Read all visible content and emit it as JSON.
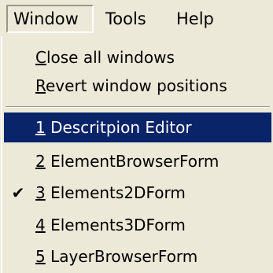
{
  "menubar": {
    "window": "Window",
    "tools": "Tools",
    "help": "Help"
  },
  "window_menu": {
    "close_all": {
      "mnemonic": "C",
      "rest": "lose all windows"
    },
    "revert": {
      "mnemonic": "R",
      "rest": "evert window positions"
    },
    "windows": [
      {
        "mnemonic": "1",
        "rest": " Descritpion Editor",
        "checked": false,
        "highlighted": true
      },
      {
        "mnemonic": "2",
        "rest": " ElementBrowserForm",
        "checked": false,
        "highlighted": false
      },
      {
        "mnemonic": "3",
        "rest": " Elements2DForm",
        "checked": true,
        "highlighted": false
      },
      {
        "mnemonic": "4",
        "rest": " Elements3DForm",
        "checked": false,
        "highlighted": false
      },
      {
        "mnemonic": "5",
        "rest": " LayerBrowserForm",
        "checked": false,
        "highlighted": false
      }
    ],
    "check_glyph": "✔"
  },
  "colors": {
    "menu_bg": "#ece9d8",
    "highlight_bg": "#0a246a",
    "highlight_text": "#ffffff",
    "shadow": "#9a978c"
  }
}
